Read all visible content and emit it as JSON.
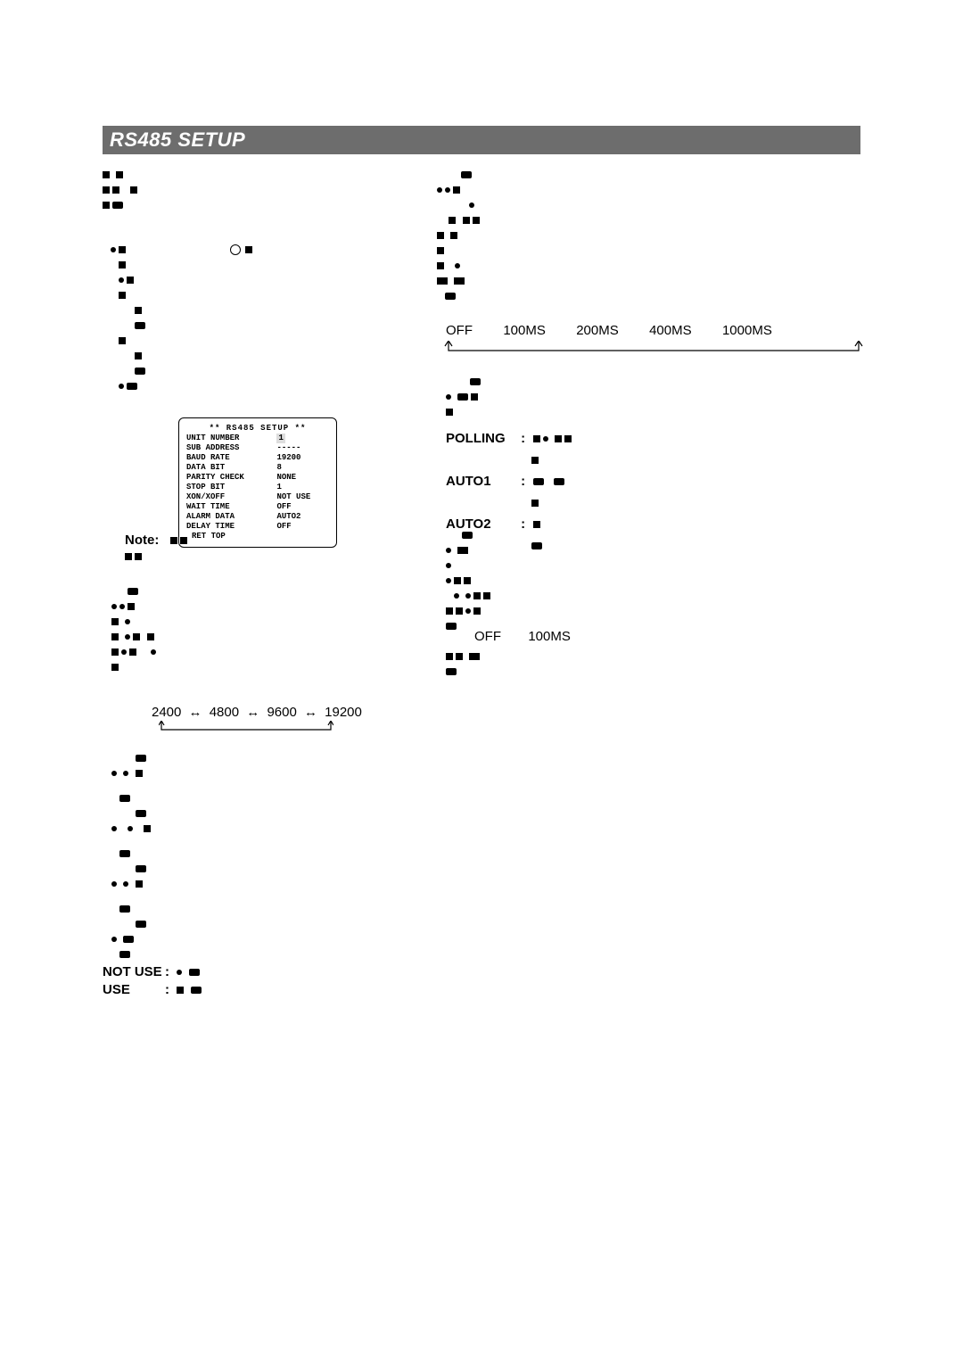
{
  "title": "RS485 SETUP",
  "screen": {
    "header": "** RS485 SETUP **",
    "rows": [
      {
        "label": "UNIT NUMBER",
        "value": "1",
        "highlight": true
      },
      {
        "label": "SUB ADDRESS",
        "value": "-----"
      },
      {
        "label": "BAUD RATE",
        "value": "19200"
      },
      {
        "label": "DATA BIT",
        "value": "8"
      },
      {
        "label": "PARITY CHECK",
        "value": "NONE"
      },
      {
        "label": "STOP BIT",
        "value": "1"
      },
      {
        "label": "XON/XOFF",
        "value": "NOT USE"
      },
      {
        "label": "WAIT TIME",
        "value": "OFF"
      },
      {
        "label": "ALARM DATA",
        "value": "AUTO2"
      },
      {
        "label": "DELAY TIME",
        "value": "OFF"
      }
    ],
    "footer": "RET TOP"
  },
  "note_label": "Note:",
  "baud_rates": [
    "2400",
    "4800",
    "9600",
    "19200"
  ],
  "xonxoff": {
    "not_use_label": "NOT USE",
    "use_label": "USE"
  },
  "wait_time_options": [
    "OFF",
    "100MS",
    "200MS",
    "400MS",
    "1000MS"
  ],
  "alarm_data_modes": {
    "polling_label": "POLLING",
    "auto1_label": "AUTO1",
    "auto2_label": "AUTO2"
  },
  "delay_time_options": [
    "OFF",
    "100MS"
  ]
}
